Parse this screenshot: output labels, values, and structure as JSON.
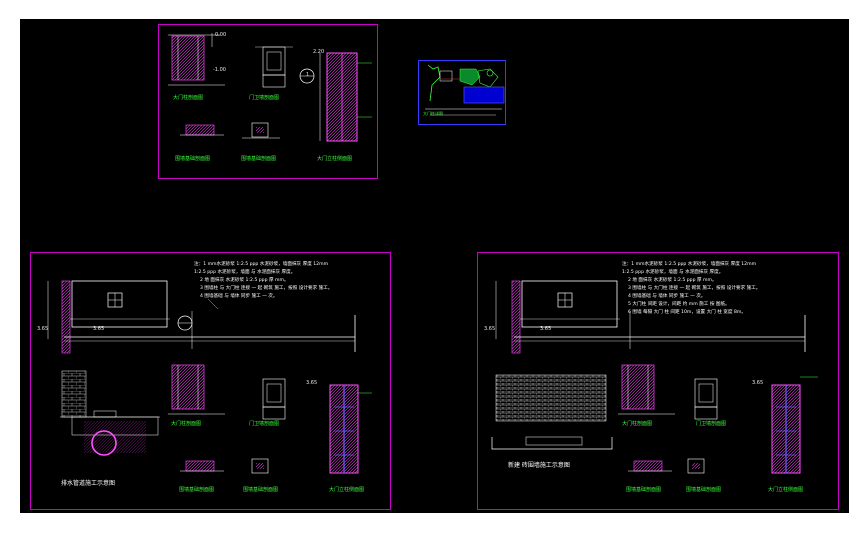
{
  "top_sheet": {
    "elev_top": "0.00",
    "elev_low": "-1.00",
    "elev_right": "2.20",
    "marker_num": "1",
    "labels": [
      "大门柱剖面图",
      "门卫墙剖面图",
      "大门立柱侧面图",
      "围墙基础剖面图",
      "围墙基础剖面图"
    ]
  },
  "small_sheet": {
    "labels": [
      "大门柱详图"
    ]
  },
  "sheet_a": {
    "title": "排水管道施工示意图",
    "dims": [
      "3.65",
      "3.65",
      "3.65"
    ],
    "notes": [
      "注：1  mm水泥砂浆 1:2.5 ppp 水泥砂浆，墙面抹灰 厚度 12mm",
      "    1:2.5 ppp 水泥砂浆，墙面 与 水泥面抹灰 厚度。",
      "2  地 面抹灰 水泥砂浆 1:2.5 ppp 厚 mm。",
      "3  围墙柱 与 大门柱 连接 一 起 砌筑 施工，按照 设计要求 施工。",
      "4  围墙基础 与 墙体 同步 施工 一 次。"
    ],
    "labels": [
      "大门柱剖面图",
      "门卫墙剖面图",
      "大门立柱侧面图",
      "围墙基础剖面图",
      "围墙基础剖面图"
    ]
  },
  "sheet_b": {
    "title": "新建 砖围墙施工示意图",
    "dims": [
      "3.65",
      "3.65",
      "3.65"
    ],
    "notes": [
      "注：1  mm水泥砂浆 1:2.5 ppp 水泥砂浆，墙面抹灰 厚度 12mm",
      "    1:2.5 ppp 水泥砂浆，墙面 与 水泥面抹灰 厚度。",
      "2  地 面抹灰 水泥砂浆 1:2.5 ppp 厚 mm。",
      "3  围墙柱 与 大门柱 连接 一 起 砌筑 施工，按照 设计要求 施工。",
      "4  围墙基础 与 墙体 同步 施工 一 次。",
      "5  大门柱 间距 设计，间距 约 mm 施工 按 图纸。",
      "6  围墙 每隔 大门 柱 间距 10m，设置 大门 柱 宽度 8m。"
    ],
    "labels": [
      "大门柱剖面图",
      "门卫墙剖面图",
      "大门立柱侧面图",
      "围墙基础剖面图",
      "围墙基础剖面图"
    ]
  },
  "colors": {
    "background": "#000000",
    "frame": "#c800c8",
    "accent": "#3cff3c"
  }
}
